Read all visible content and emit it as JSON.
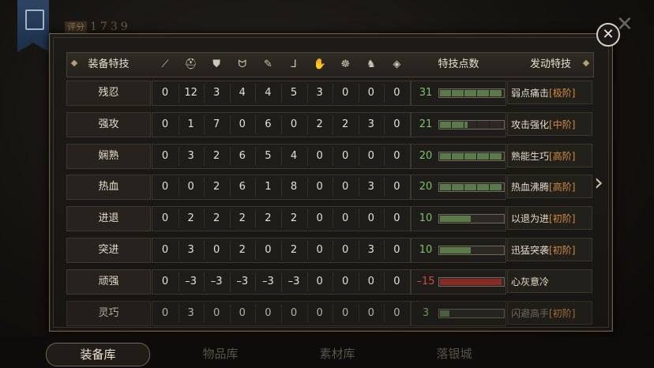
{
  "score": {
    "label": "评分",
    "value": "1739"
  },
  "close_icon": "close-icon",
  "header": {
    "col_name": "装备特技",
    "icons": [
      "sword-icon",
      "helmet-icon",
      "armor-icon",
      "claw-icon",
      "scroll-icon",
      "boot-icon",
      "glove-icon",
      "beast-icon",
      "horse-icon",
      "gem-icon"
    ],
    "col_points": "特技点数",
    "col_skill": "发动特技"
  },
  "rows": [
    {
      "name": "残忍",
      "values": [
        "0",
        "12",
        "3",
        "4",
        "4",
        "5",
        "3",
        "0",
        "0",
        "0"
      ],
      "points": "31",
      "fill": 1.0,
      "segments": 5,
      "negative": false,
      "skill": "弱点痛击",
      "tier": "[极阶]",
      "dim": false
    },
    {
      "name": "强攻",
      "values": [
        "0",
        "1",
        "7",
        "0",
        "6",
        "0",
        "2",
        "2",
        "3",
        "0"
      ],
      "points": "21",
      "fill": 0.45,
      "segments": 5,
      "negative": false,
      "skill": "攻击强化",
      "tier": "[中阶]",
      "dim": false
    },
    {
      "name": "娴熟",
      "values": [
        "0",
        "3",
        "2",
        "6",
        "5",
        "4",
        "0",
        "0",
        "0",
        "0"
      ],
      "points": "20",
      "fill": 1.0,
      "segments": 0,
      "negative": false,
      "skill": "熟能生巧",
      "tier": "[高阶]",
      "dim": false
    },
    {
      "name": "热血",
      "values": [
        "0",
        "0",
        "2",
        "6",
        "1",
        "8",
        "0",
        "0",
        "3",
        "0"
      ],
      "points": "20",
      "fill": 1.0,
      "segments": 0,
      "negative": false,
      "skill": "热血沸腾",
      "tier": "[高阶]",
      "dim": false
    },
    {
      "name": "进退",
      "values": [
        "0",
        "2",
        "2",
        "2",
        "2",
        "2",
        "0",
        "0",
        "0",
        "0"
      ],
      "points": "10",
      "fill": 0.5,
      "segments": 0,
      "negative": false,
      "skill": "以退为进",
      "tier": "[初阶]",
      "dim": false
    },
    {
      "name": "突进",
      "values": [
        "0",
        "3",
        "0",
        "2",
        "0",
        "2",
        "0",
        "0",
        "3",
        "0"
      ],
      "points": "10",
      "fill": 0.5,
      "segments": 0,
      "negative": false,
      "skill": "迅猛突袭",
      "tier": "[初阶]",
      "dim": false
    },
    {
      "name": "顽强",
      "values": [
        "0",
        "–3",
        "–3",
        "–3",
        "–3",
        "–3",
        "0",
        "0",
        "0",
        "0"
      ],
      "points": "–15",
      "fill": 1.0,
      "segments": 0,
      "negative": true,
      "skill": "心灰意冷",
      "tier": "",
      "dim": false
    },
    {
      "name": "灵巧",
      "values": [
        "0",
        "3",
        "0",
        "0",
        "0",
        "0",
        "0",
        "0",
        "0",
        "0"
      ],
      "points": "3",
      "fill": 0.15,
      "segments": 0,
      "negative": false,
      "skill": "闪避高手",
      "tier": "[初阶]",
      "dim": true
    }
  ],
  "tabs": [
    {
      "label": "装备库",
      "active": true
    },
    {
      "label": "物品库",
      "active": false
    },
    {
      "label": "素材库",
      "active": false
    },
    {
      "label": "落银城",
      "active": false
    }
  ],
  "colors": {
    "positive": "#7fc06a",
    "negative": "#d24a3a",
    "tier": "#d18a42",
    "bar_fill": "#5a7a4a",
    "bar_negative": "#8a2a25"
  }
}
